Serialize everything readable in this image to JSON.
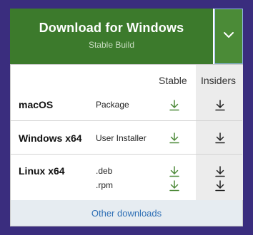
{
  "download": {
    "title": "Download for Windows",
    "subtitle": "Stable Build"
  },
  "table": {
    "headers": {
      "stable": "Stable",
      "insiders": "Insiders"
    },
    "rows": [
      {
        "os": "macOS",
        "kinds": [
          "Package"
        ]
      },
      {
        "os": "Windows x64",
        "kinds": [
          "User Installer"
        ]
      },
      {
        "os": "Linux x64",
        "kinds": [
          ".deb",
          ".rpm"
        ]
      }
    ]
  },
  "footer": {
    "link": "Other downloads"
  },
  "colors": {
    "background": "#3a2d7e",
    "button": "#3c7a2c",
    "button_secondary": "#4b8b37",
    "stable_icon": "#4e8a3a",
    "insiders_icon": "#222222",
    "link": "#2f6fb5"
  },
  "icons": {
    "chevron": "chevron-down-icon",
    "download": "download-arrow-icon"
  }
}
